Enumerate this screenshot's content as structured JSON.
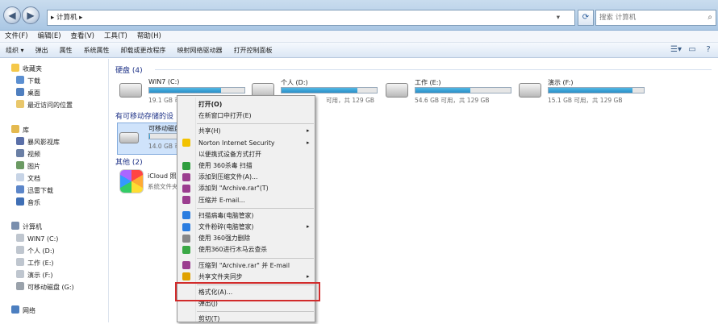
{
  "window": {
    "address": "▸ 计算机 ▸",
    "search_placeholder": "搜索 计算机",
    "back_icon": "back-arrow-icon",
    "forward_icon": "forward-arrow-icon"
  },
  "menubar": [
    "文件(F)",
    "编辑(E)",
    "查看(V)",
    "工具(T)",
    "帮助(H)"
  ],
  "toolbar": [
    "组织 ▾",
    "弹出",
    "属性",
    "系统属性",
    "卸载或更改程序",
    "映射网络驱动器",
    "打开控制面板"
  ],
  "sidebar": {
    "favorites": {
      "title": "收藏夹",
      "items": [
        "下载",
        "桌面",
        "最近访问的位置"
      ]
    },
    "libraries": {
      "title": "库",
      "items": [
        "暴风影视库",
        "视频",
        "图片",
        "文档",
        "迅雷下载",
        "音乐"
      ]
    },
    "computer": {
      "title": "计算机",
      "items": [
        "WIN7 (C:)",
        "个人 (D:)",
        "工作 (E:)",
        "演示 (F:)",
        "可移动磁盘 (G:)"
      ]
    },
    "network": {
      "title": "网络"
    }
  },
  "sections": {
    "hard_disks": "硬盘 (4)",
    "removable": "有可移动存储的设",
    "others": "其他 (2)"
  },
  "drives": [
    {
      "name": "WIN7 (C:)",
      "info": "19.1 GB 可用",
      "used_fraction": 0.75
    },
    {
      "name": "个人 (D:)",
      "info": "可用，共 129 GB",
      "used_fraction": 0.8
    },
    {
      "name": "工作 (E:)",
      "info": "54.6 GB 可用，共 129 GB",
      "used_fraction": 0.58
    },
    {
      "name": "演示 (F:)",
      "info": "15.1 GB 可用，共 129 GB",
      "used_fraction": 0.88
    }
  ],
  "removable_drive": {
    "name": "可移动磁盘",
    "info": "14.0 GB 可用",
    "used_fraction": 0.02
  },
  "other_item": {
    "name": "iCloud 照片",
    "info": "系统文件夹"
  },
  "context_menu": [
    {
      "label": "打开(O)",
      "bold": true
    },
    {
      "label": "在新窗口中打开(E)"
    },
    {
      "sep": true
    },
    {
      "label": "共享(H)",
      "arrow": true
    },
    {
      "label": "Norton Internet Security",
      "arrow": true,
      "icon": "norton-icon"
    },
    {
      "label": "以便携式设备方式打开"
    },
    {
      "label": "使用 360杀毒 扫描",
      "icon": "360-shield-icon"
    },
    {
      "label": "添加到压缩文件(A)...",
      "icon": "winrar-icon"
    },
    {
      "label": "添加到 \"Archive.rar\"(T)",
      "icon": "winrar-icon"
    },
    {
      "label": "压缩并 E-mail...",
      "icon": "winrar-icon"
    },
    {
      "sep": true
    },
    {
      "label": "扫描病毒(电脑管家)",
      "icon": "tencent-shield-icon"
    },
    {
      "label": "文件粉碎(电脑管家)",
      "arrow": true,
      "icon": "tencent-shield-icon"
    },
    {
      "label": "使用 360强力删除",
      "icon": "360-delete-icon"
    },
    {
      "label": "使用360进行木马云查杀",
      "icon": "360-cloud-icon"
    },
    {
      "sep": true
    },
    {
      "label": "压缩到 \"Archive.rar\" 并 E-mail",
      "icon": "winrar-icon"
    },
    {
      "label": "共享文件夹同步",
      "arrow": true,
      "icon": "sync-icon"
    },
    {
      "sep": true
    },
    {
      "label": "格式化(A)..."
    },
    {
      "label": "弹出(J)"
    },
    {
      "sep": true
    },
    {
      "label": "剪切(T)"
    }
  ],
  "colors": {
    "accent": "#1e3287",
    "highlight_box": "#d12b2b",
    "progress": "#2a8fc7"
  }
}
